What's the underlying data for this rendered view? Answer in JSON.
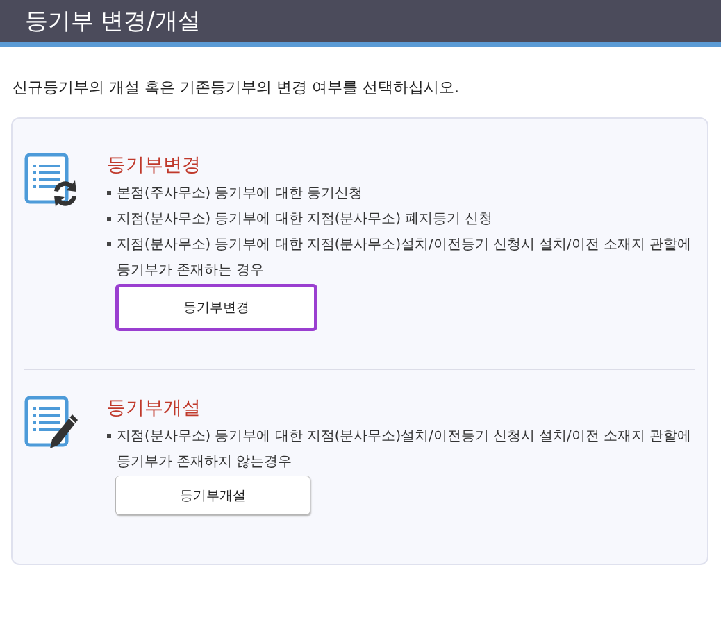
{
  "header": {
    "title": "등기부 변경/개설"
  },
  "instruction": "신규등기부의 개설 혹은 기존등기부의 변경 여부를 선택하십시오.",
  "sections": [
    {
      "kind": "change",
      "heading": "등기부변경",
      "bullets": [
        "본점(주사무소) 등기부에 대한 등기신청",
        "지점(분사무소) 등기부에 대한 지점(분사무소) 폐지등기 신청",
        "지점(분사무소) 등기부에 대한 지점(분사무소)설치/이전등기 신청시 설치/이전 소재지 관할에 등기부가 존재하는 경우"
      ],
      "button": {
        "label": "등기부변경",
        "highlighted": true
      }
    },
    {
      "kind": "open",
      "heading": "등기부개설",
      "bullets": [
        "지점(분사무소) 등기부에 대한 지점(분사무소)설치/이전등기 신청시 설치/이전 소재지 관할에 등기부가 존재하지 않는경우"
      ],
      "button": {
        "label": "등기부개설",
        "highlighted": false
      }
    }
  ]
}
